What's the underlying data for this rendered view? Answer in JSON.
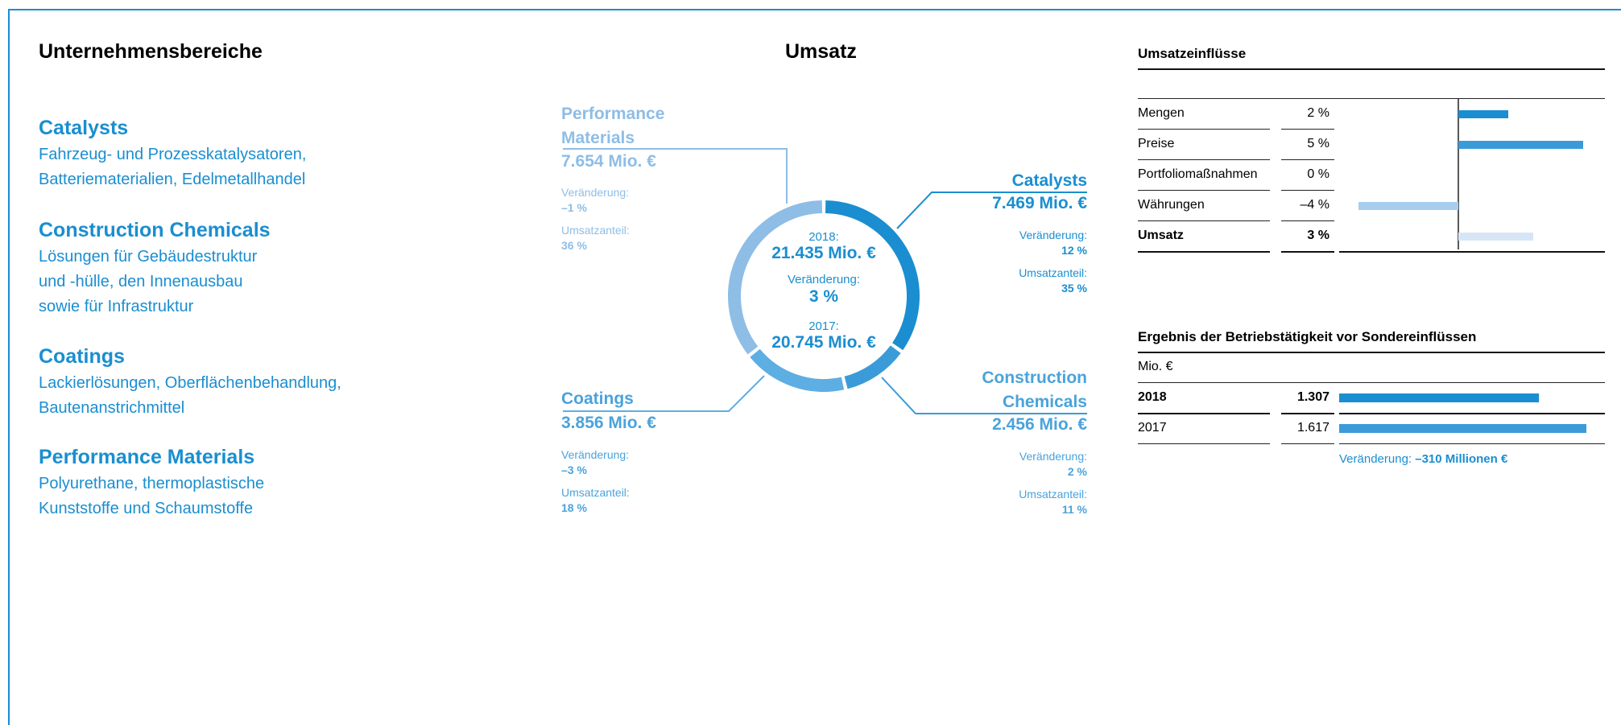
{
  "left": {
    "heading": "Unternehmensbereiche",
    "items": [
      {
        "title": "Catalysts",
        "desc": "Fahrzeug- und Prozesskatalysatoren,\nBatteriematerialien, Edelmetallhandel"
      },
      {
        "title": "Construction Chemicals",
        "desc": "Lösungen für Gebäudestruktur\nund -hülle, den Innenausbau\nsowie für Infrastruktur"
      },
      {
        "title": "Coatings",
        "desc": "Lackierlösungen, Oberflächenbehandlung,\nBautenanstrichmittel"
      },
      {
        "title": "Performance Materials",
        "desc": "Polyurethane, thermoplastische\nKunststoffe und Schaumstoffe"
      }
    ]
  },
  "middle": {
    "heading": "Umsatz",
    "center": {
      "label_2018": "2018:",
      "value_2018": "21.435 Mio. €",
      "label_change": "Veränderung:",
      "value_change": "3 %",
      "label_2017": "2017:",
      "value_2017": "20.745 Mio. €"
    },
    "segments": [
      {
        "name": "Performance\nMaterials",
        "value": "7.654 Mio. €",
        "change_label": "Veränderung:",
        "change": "–1 %",
        "share_label": "Umsatzanteil:",
        "share": "36 %",
        "color": "#8ebde6"
      },
      {
        "name": "Catalysts",
        "value": "7.469 Mio. €",
        "change_label": "Veränderung:",
        "change": "12 %",
        "share_label": "Umsatzanteil:",
        "share": "35 %",
        "color": "#1a8ed0"
      },
      {
        "name": "Construction\nChemicals",
        "value": "2.456 Mio. €",
        "change_label": "Veränderung:",
        "change": "2 %",
        "share_label": "Umsatzanteil:",
        "share": "11 %",
        "color": "#3a9bd8"
      },
      {
        "name": "Coatings",
        "value": "3.856 Mio. €",
        "change_label": "Veränderung:",
        "change": "–3 %",
        "share_label": "Umsatzanteil:",
        "share": "18 %",
        "color": "#5daee2"
      }
    ]
  },
  "influences": {
    "heading": "Umsatzeinflüsse",
    "rows": [
      {
        "label": "Mengen",
        "value": "2 %",
        "bold": false
      },
      {
        "label": "Preise",
        "value": "5 %",
        "bold": false
      },
      {
        "label": "Portfoliomaßnahmen",
        "value": "0 %",
        "bold": false
      },
      {
        "label": "Währungen",
        "value": "–4 %",
        "bold": false
      },
      {
        "label": "Umsatz",
        "value": "3 %",
        "bold": true
      }
    ]
  },
  "ebit": {
    "heading": "Ergebnis der Betriebstätigkeit vor Sondereinflüssen",
    "unit": "Mio. €",
    "rows": [
      {
        "label": "2018",
        "value": "1.307",
        "bold": true
      },
      {
        "label": "2017",
        "value": "1.617",
        "bold": false
      }
    ],
    "change_label": "Veränderung: ",
    "change_value": "–310 Millionen €"
  },
  "chart_data": [
    {
      "type": "pie",
      "title": "Umsatz",
      "categories": [
        "Catalysts",
        "Construction Chemicals",
        "Coatings",
        "Performance Materials"
      ],
      "values": [
        7469,
        2456,
        3856,
        7654
      ],
      "shares": [
        35,
        11,
        18,
        36
      ],
      "colors": [
        "#1a8ed0",
        "#3a9bd8",
        "#5daee2",
        "#8ebde6"
      ]
    },
    {
      "type": "bar",
      "title": "Umsatzeinflüsse",
      "categories": [
        "Mengen",
        "Preise",
        "Portfoliomaßnahmen",
        "Währungen",
        "Umsatz"
      ],
      "values": [
        2,
        5,
        0,
        -4,
        3
      ],
      "colors": [
        "#1a8ed0",
        "#3a9bd8",
        "#3a9bd8",
        "#a9cdee",
        "#d6e6f6"
      ]
    },
    {
      "type": "bar",
      "title": "Ergebnis der Betriebstätigkeit vor Sondereinflüssen",
      "categories": [
        "2018",
        "2017"
      ],
      "values": [
        1307,
        1617
      ],
      "colors": [
        "#1a8ed0",
        "#3a9bd8"
      ]
    }
  ]
}
